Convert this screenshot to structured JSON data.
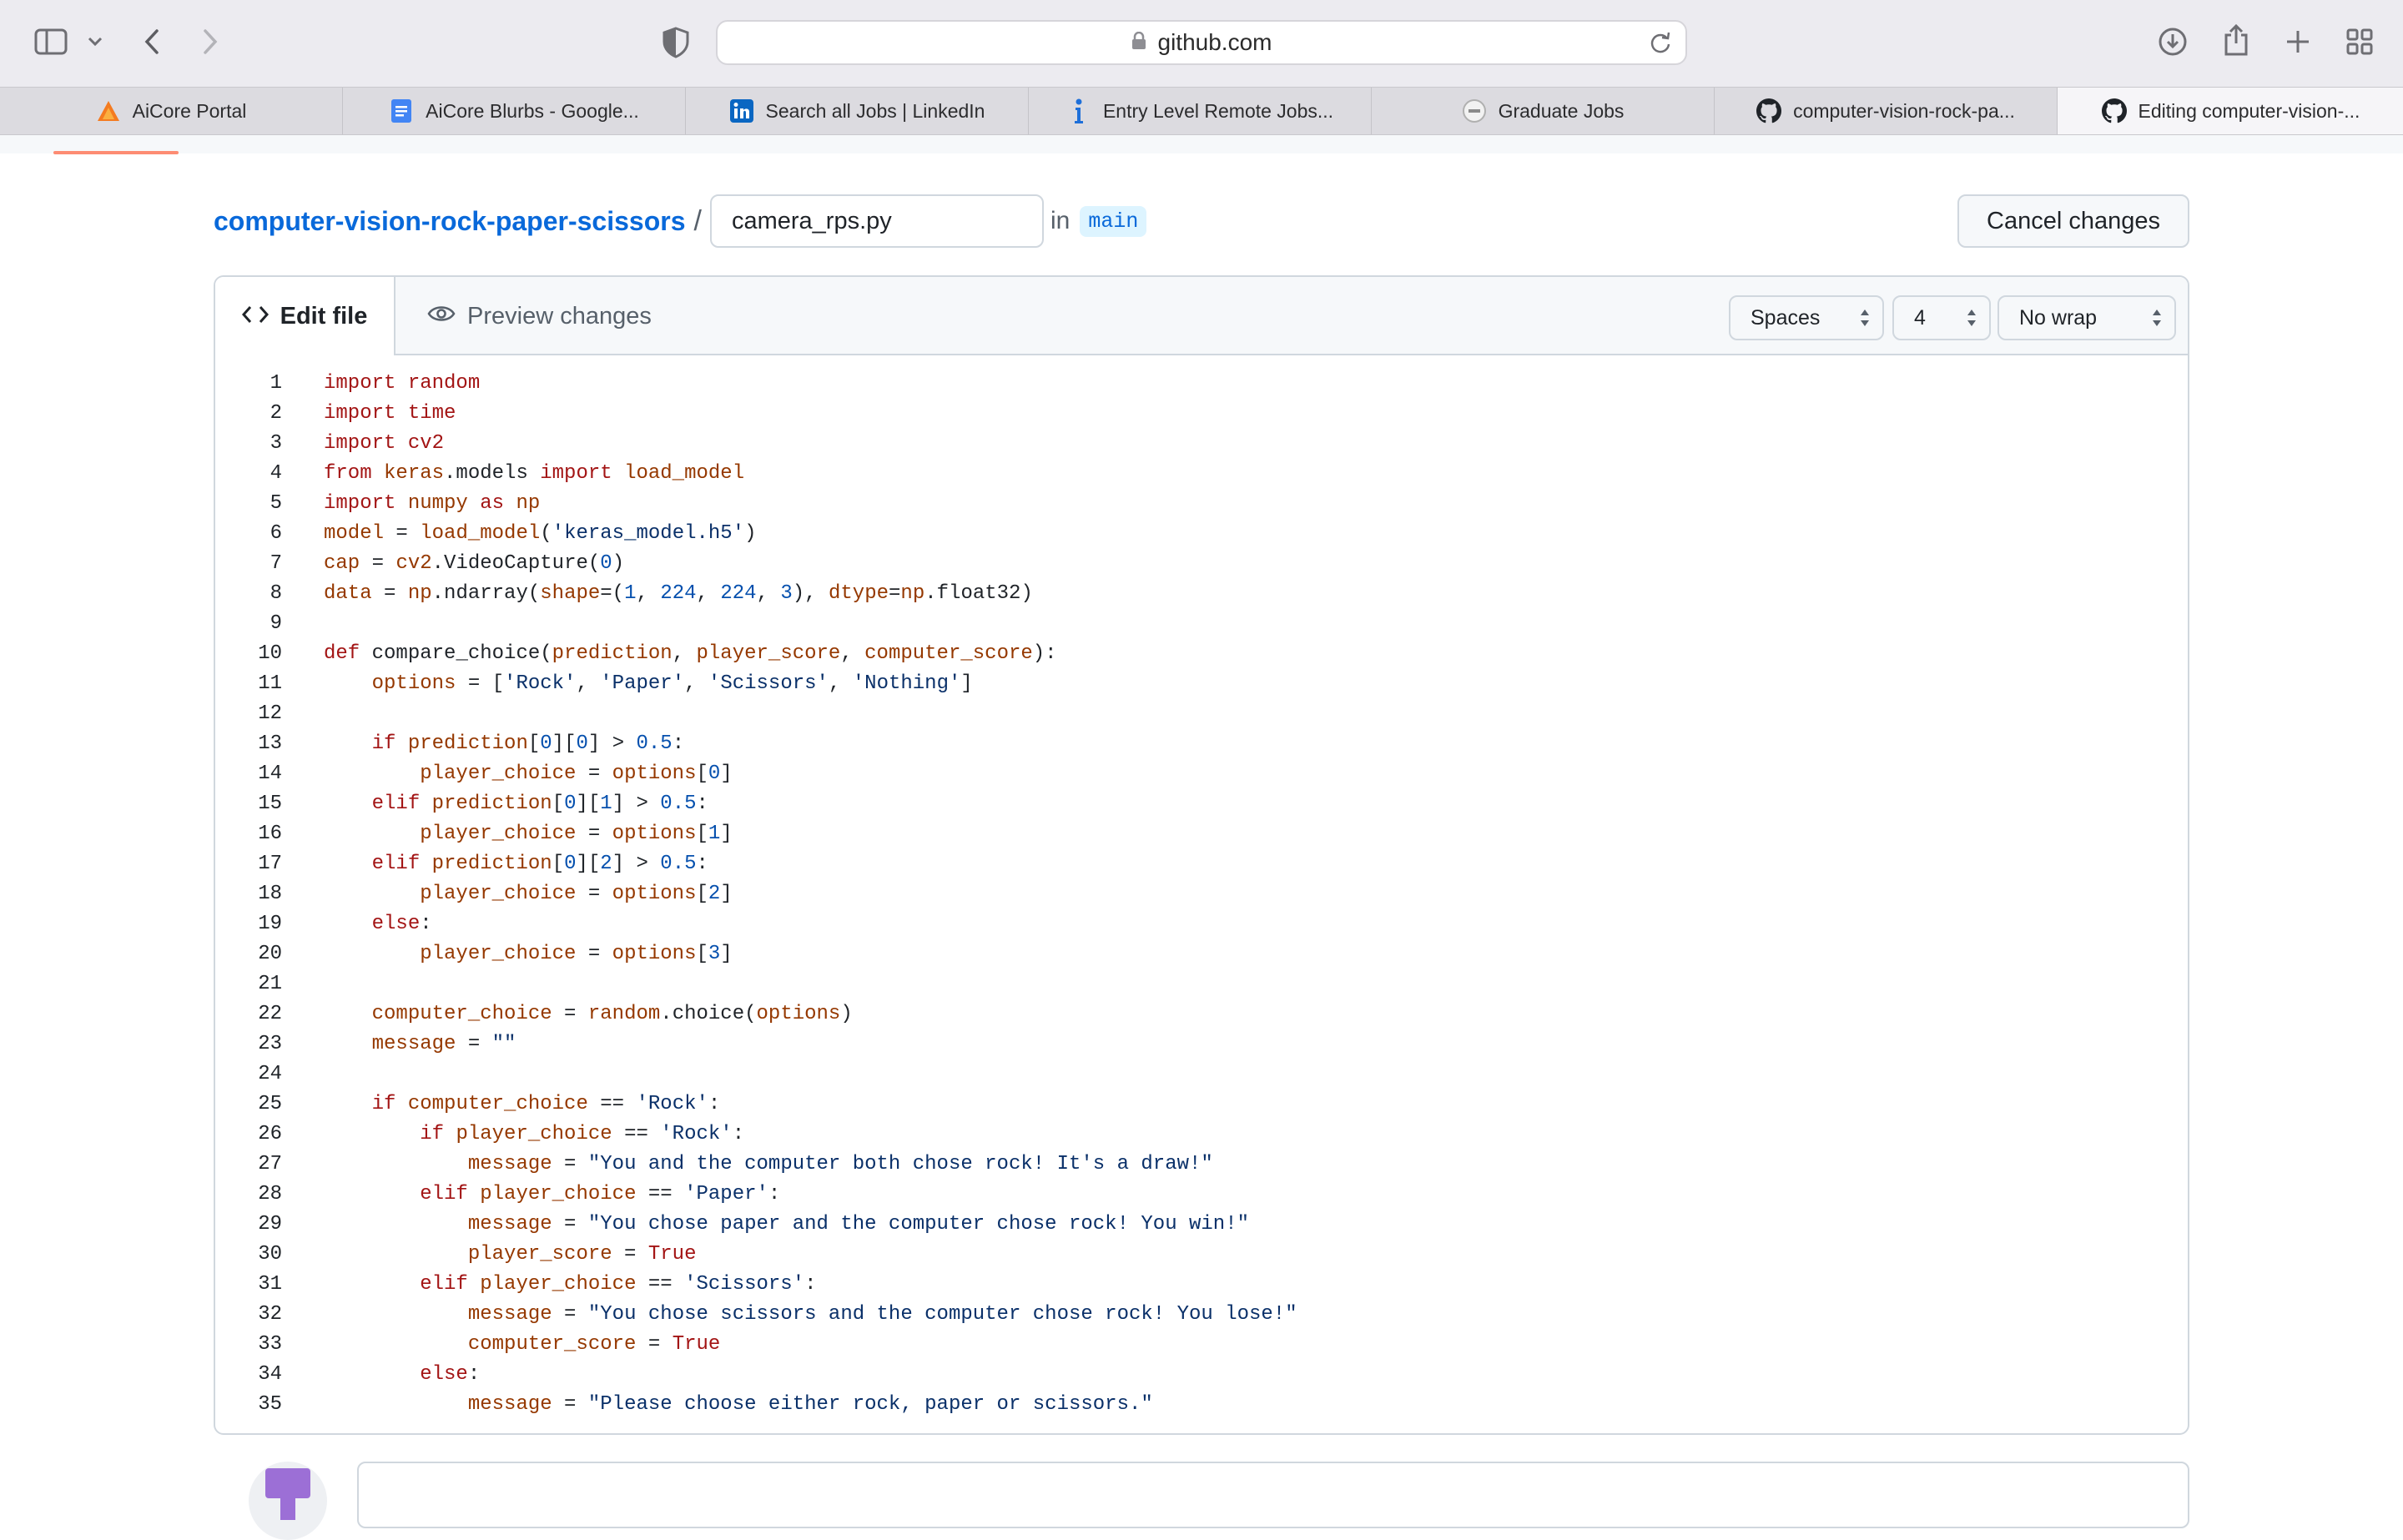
{
  "browser": {
    "address": "github.com",
    "tabs": [
      {
        "label": "AiCore Portal",
        "icon": "aicore-icon"
      },
      {
        "label": "AiCore Blurbs - Google...",
        "icon": "google-docs-icon"
      },
      {
        "label": "Search all Jobs | LinkedIn",
        "icon": "linkedin-icon"
      },
      {
        "label": "Entry Level Remote Jobs...",
        "icon": "info-icon"
      },
      {
        "label": "Graduate Jobs",
        "icon": "graduate-jobs-icon"
      },
      {
        "label": "computer-vision-rock-pa...",
        "icon": "github-icon"
      },
      {
        "label": "Editing computer-vision-...",
        "icon": "github-icon"
      }
    ],
    "active_tab_index": 6
  },
  "editor": {
    "repo_name": "computer-vision-rock-paper-scissors",
    "separator": "/",
    "filename": "camera_rps.py",
    "in_label": "in",
    "branch": "main",
    "cancel_label": "Cancel changes",
    "edit_tab_label": "Edit file",
    "preview_tab_label": "Preview changes",
    "indent_mode": "Spaces",
    "indent_size": "4",
    "wrap_mode": "No wrap"
  },
  "colors": {
    "keyword": "#a31515",
    "string": "#0a3069",
    "number": "#0550ae",
    "link": "#0969da",
    "active_tab_underline": "#fd8c73"
  },
  "code": [
    [
      {
        "t": "import",
        "c": "kw"
      },
      {
        "t": " random",
        "c": "kw"
      }
    ],
    [
      {
        "t": "import",
        "c": "kw"
      },
      {
        "t": " time",
        "c": "kw"
      }
    ],
    [
      {
        "t": "import",
        "c": "kw"
      },
      {
        "t": " cv2",
        "c": "kw"
      }
    ],
    [
      {
        "t": "from",
        "c": "kw"
      },
      {
        "t": " keras",
        "c": "var"
      },
      {
        "t": ".models "
      },
      {
        "t": "import",
        "c": "kw"
      },
      {
        "t": " load_model",
        "c": "var"
      }
    ],
    [
      {
        "t": "import",
        "c": "kw"
      },
      {
        "t": " numpy ",
        "c": "var"
      },
      {
        "t": "as",
        "c": "kw"
      },
      {
        "t": " np",
        "c": "var"
      }
    ],
    [
      {
        "t": "model",
        "c": "var"
      },
      {
        "t": " = "
      },
      {
        "t": "load_model",
        "c": "var"
      },
      {
        "t": "("
      },
      {
        "t": "'keras_model.h5'",
        "c": "str"
      },
      {
        "t": ")"
      }
    ],
    [
      {
        "t": "cap",
        "c": "var"
      },
      {
        "t": " = "
      },
      {
        "t": "cv2",
        "c": "var"
      },
      {
        "t": ".VideoCapture("
      },
      {
        "t": "0",
        "c": "num"
      },
      {
        "t": ")"
      }
    ],
    [
      {
        "t": "data",
        "c": "var"
      },
      {
        "t": " = "
      },
      {
        "t": "np",
        "c": "var"
      },
      {
        "t": ".ndarray("
      },
      {
        "t": "shape",
        "c": "var"
      },
      {
        "t": "=("
      },
      {
        "t": "1",
        "c": "num"
      },
      {
        "t": ", "
      },
      {
        "t": "224",
        "c": "num"
      },
      {
        "t": ", "
      },
      {
        "t": "224",
        "c": "num"
      },
      {
        "t": ", "
      },
      {
        "t": "3",
        "c": "num"
      },
      {
        "t": "), "
      },
      {
        "t": "dtype",
        "c": "var"
      },
      {
        "t": "="
      },
      {
        "t": "np",
        "c": "var"
      },
      {
        "t": ".float32)"
      }
    ],
    [],
    [
      {
        "t": "def",
        "c": "kw"
      },
      {
        "t": " compare_choice("
      },
      {
        "t": "prediction",
        "c": "var"
      },
      {
        "t": ", "
      },
      {
        "t": "player_score",
        "c": "var"
      },
      {
        "t": ", "
      },
      {
        "t": "computer_score",
        "c": "var"
      },
      {
        "t": "):"
      }
    ],
    [
      {
        "t": "    "
      },
      {
        "t": "options",
        "c": "var"
      },
      {
        "t": " = ["
      },
      {
        "t": "'Rock'",
        "c": "str"
      },
      {
        "t": ", "
      },
      {
        "t": "'Paper'",
        "c": "str"
      },
      {
        "t": ", "
      },
      {
        "t": "'Scissors'",
        "c": "str"
      },
      {
        "t": ", "
      },
      {
        "t": "'Nothing'",
        "c": "str"
      },
      {
        "t": "]"
      }
    ],
    [],
    [
      {
        "t": "    "
      },
      {
        "t": "if",
        "c": "kw"
      },
      {
        "t": " "
      },
      {
        "t": "prediction",
        "c": "var"
      },
      {
        "t": "["
      },
      {
        "t": "0",
        "c": "num"
      },
      {
        "t": "]["
      },
      {
        "t": "0",
        "c": "num"
      },
      {
        "t": "] > "
      },
      {
        "t": "0.5",
        "c": "num"
      },
      {
        "t": ":"
      }
    ],
    [
      {
        "t": "        "
      },
      {
        "t": "player_choice",
        "c": "var"
      },
      {
        "t": " = "
      },
      {
        "t": "options",
        "c": "var"
      },
      {
        "t": "["
      },
      {
        "t": "0",
        "c": "num"
      },
      {
        "t": "]"
      }
    ],
    [
      {
        "t": "    "
      },
      {
        "t": "elif",
        "c": "kw"
      },
      {
        "t": " "
      },
      {
        "t": "prediction",
        "c": "var"
      },
      {
        "t": "["
      },
      {
        "t": "0",
        "c": "num"
      },
      {
        "t": "]["
      },
      {
        "t": "1",
        "c": "num"
      },
      {
        "t": "] > "
      },
      {
        "t": "0.5",
        "c": "num"
      },
      {
        "t": ":"
      }
    ],
    [
      {
        "t": "        "
      },
      {
        "t": "player_choice",
        "c": "var"
      },
      {
        "t": " = "
      },
      {
        "t": "options",
        "c": "var"
      },
      {
        "t": "["
      },
      {
        "t": "1",
        "c": "num"
      },
      {
        "t": "]"
      }
    ],
    [
      {
        "t": "    "
      },
      {
        "t": "elif",
        "c": "kw"
      },
      {
        "t": " "
      },
      {
        "t": "prediction",
        "c": "var"
      },
      {
        "t": "["
      },
      {
        "t": "0",
        "c": "num"
      },
      {
        "t": "]["
      },
      {
        "t": "2",
        "c": "num"
      },
      {
        "t": "] > "
      },
      {
        "t": "0.5",
        "c": "num"
      },
      {
        "t": ":"
      }
    ],
    [
      {
        "t": "        "
      },
      {
        "t": "player_choice",
        "c": "var"
      },
      {
        "t": " = "
      },
      {
        "t": "options",
        "c": "var"
      },
      {
        "t": "["
      },
      {
        "t": "2",
        "c": "num"
      },
      {
        "t": "]"
      }
    ],
    [
      {
        "t": "    "
      },
      {
        "t": "else",
        "c": "kw"
      },
      {
        "t": ":"
      }
    ],
    [
      {
        "t": "        "
      },
      {
        "t": "player_choice",
        "c": "var"
      },
      {
        "t": " = "
      },
      {
        "t": "options",
        "c": "var"
      },
      {
        "t": "["
      },
      {
        "t": "3",
        "c": "num"
      },
      {
        "t": "]"
      }
    ],
    [],
    [
      {
        "t": "    "
      },
      {
        "t": "computer_choice",
        "c": "var"
      },
      {
        "t": " = "
      },
      {
        "t": "random",
        "c": "var"
      },
      {
        "t": ".choice("
      },
      {
        "t": "options",
        "c": "var"
      },
      {
        "t": ")"
      }
    ],
    [
      {
        "t": "    "
      },
      {
        "t": "message",
        "c": "var"
      },
      {
        "t": " = "
      },
      {
        "t": "\"\"",
        "c": "str"
      }
    ],
    [],
    [
      {
        "t": "    "
      },
      {
        "t": "if",
        "c": "kw"
      },
      {
        "t": " "
      },
      {
        "t": "computer_choice",
        "c": "var"
      },
      {
        "t": " == "
      },
      {
        "t": "'Rock'",
        "c": "str"
      },
      {
        "t": ":"
      }
    ],
    [
      {
        "t": "        "
      },
      {
        "t": "if",
        "c": "kw"
      },
      {
        "t": " "
      },
      {
        "t": "player_choice",
        "c": "var"
      },
      {
        "t": " == "
      },
      {
        "t": "'Rock'",
        "c": "str"
      },
      {
        "t": ":"
      }
    ],
    [
      {
        "t": "            "
      },
      {
        "t": "message",
        "c": "var"
      },
      {
        "t": " = "
      },
      {
        "t": "\"You and the computer both chose rock! It's a draw!\"",
        "c": "str"
      }
    ],
    [
      {
        "t": "        "
      },
      {
        "t": "elif",
        "c": "kw"
      },
      {
        "t": " "
      },
      {
        "t": "player_choice",
        "c": "var"
      },
      {
        "t": " == "
      },
      {
        "t": "'Paper'",
        "c": "str"
      },
      {
        "t": ":"
      }
    ],
    [
      {
        "t": "            "
      },
      {
        "t": "message",
        "c": "var"
      },
      {
        "t": " = "
      },
      {
        "t": "\"You chose paper and the computer chose rock! You win!\"",
        "c": "str"
      }
    ],
    [
      {
        "t": "            "
      },
      {
        "t": "player_score",
        "c": "var"
      },
      {
        "t": " = "
      },
      {
        "t": "True",
        "c": "kw"
      }
    ],
    [
      {
        "t": "        "
      },
      {
        "t": "elif",
        "c": "kw"
      },
      {
        "t": " "
      },
      {
        "t": "player_choice",
        "c": "var"
      },
      {
        "t": " == "
      },
      {
        "t": "'Scissors'",
        "c": "str"
      },
      {
        "t": ":"
      }
    ],
    [
      {
        "t": "            "
      },
      {
        "t": "message",
        "c": "var"
      },
      {
        "t": " = "
      },
      {
        "t": "\"You chose scissors and the computer chose rock! You lose!\"",
        "c": "str"
      }
    ],
    [
      {
        "t": "            "
      },
      {
        "t": "computer_score",
        "c": "var"
      },
      {
        "t": " = "
      },
      {
        "t": "True",
        "c": "kw"
      }
    ],
    [
      {
        "t": "        "
      },
      {
        "t": "else",
        "c": "kw"
      },
      {
        "t": ":"
      }
    ],
    [
      {
        "t": "            "
      },
      {
        "t": "message",
        "c": "var"
      },
      {
        "t": " = "
      },
      {
        "t": "\"Please choose either rock, paper or scissors.\"",
        "c": "str"
      }
    ]
  ]
}
